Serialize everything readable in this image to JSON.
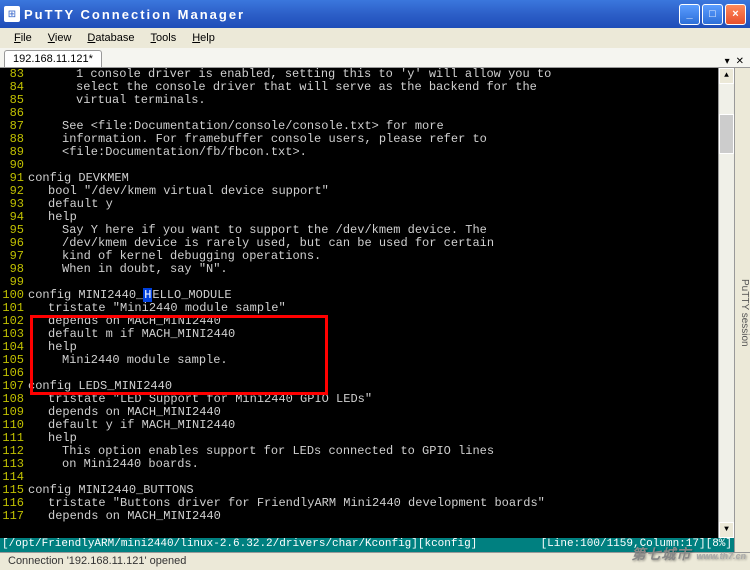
{
  "window": {
    "title": "PuTTY Connection Manager"
  },
  "menu": {
    "file": "File",
    "view": "View",
    "database": "Database",
    "tools": "Tools",
    "help": "Help"
  },
  "tab": {
    "label": "192.168.11.121*"
  },
  "sidetab": {
    "label": "PuTTY session"
  },
  "lines": [
    {
      "n": "83",
      "ind": "ind4",
      "t": "1 console driver is enabled, setting this to 'y' will allow you to"
    },
    {
      "n": "84",
      "ind": "ind4",
      "t": "select the console driver that will serve as the backend for the"
    },
    {
      "n": "85",
      "ind": "ind4",
      "t": "virtual terminals."
    },
    {
      "n": "86",
      "ind": "ind1",
      "t": ""
    },
    {
      "n": "87",
      "ind": "ind3",
      "t": "See <file:Documentation/console/console.txt> for more"
    },
    {
      "n": "88",
      "ind": "ind3",
      "t": "information. For framebuffer console users, please refer to"
    },
    {
      "n": "89",
      "ind": "ind3",
      "t": "<file:Documentation/fb/fbcon.txt>."
    },
    {
      "n": "90",
      "ind": "ind1",
      "t": ""
    },
    {
      "n": "91",
      "ind": "ind1",
      "t": "config DEVKMEM"
    },
    {
      "n": "92",
      "ind": "ind2",
      "t": "bool \"/dev/kmem virtual device support\""
    },
    {
      "n": "93",
      "ind": "ind2",
      "t": "default y"
    },
    {
      "n": "94",
      "ind": "ind2",
      "t": "help"
    },
    {
      "n": "95",
      "ind": "ind3",
      "t": "Say Y here if you want to support the /dev/kmem device. The"
    },
    {
      "n": "96",
      "ind": "ind3",
      "t": "/dev/kmem device is rarely used, but can be used for certain"
    },
    {
      "n": "97",
      "ind": "ind3",
      "t": "kind of kernel debugging operations."
    },
    {
      "n": "98",
      "ind": "ind3",
      "t": "When in doubt, say \"N\"."
    },
    {
      "n": "99",
      "ind": "ind1",
      "t": ""
    },
    {
      "n": "100",
      "ind": "ind1",
      "t": "config MINI2440_"
    },
    {
      "n": "101",
      "ind": "ind2",
      "t": "tristate \"Mini2440 module sample\""
    },
    {
      "n": "102",
      "ind": "ind2",
      "t": "depends on MACH_MINI2440"
    },
    {
      "n": "103",
      "ind": "ind2",
      "t": "default m if MACH_MINI2440"
    },
    {
      "n": "104",
      "ind": "ind2",
      "t": "help"
    },
    {
      "n": "105",
      "ind": "ind3",
      "t": "Mini2440 module sample."
    },
    {
      "n": "106",
      "ind": "ind1",
      "t": ""
    },
    {
      "n": "107",
      "ind": "ind1",
      "t": "config LEDS_MINI2440"
    },
    {
      "n": "108",
      "ind": "ind2",
      "t": "tristate \"LED Support for Mini2440 GPIO LEDs\""
    },
    {
      "n": "109",
      "ind": "ind2",
      "t": "depends on MACH_MINI2440"
    },
    {
      "n": "110",
      "ind": "ind2",
      "t": "default y if MACH_MINI2440"
    },
    {
      "n": "111",
      "ind": "ind2",
      "t": "help"
    },
    {
      "n": "112",
      "ind": "ind3",
      "t": "This option enables support for LEDs connected to GPIO lines"
    },
    {
      "n": "113",
      "ind": "ind3",
      "t": "on Mini2440 boards."
    },
    {
      "n": "114",
      "ind": "ind1",
      "t": ""
    },
    {
      "n": "115",
      "ind": "ind1",
      "t": "config MINI2440_BUTTONS"
    },
    {
      "n": "116",
      "ind": "ind2",
      "t": "tristate \"Buttons driver for FriendlyARM Mini2440 development boards\""
    },
    {
      "n": "117",
      "ind": "ind2",
      "t": "depends on MACH_MINI2440"
    }
  ],
  "cursor": {
    "pre": "H",
    "post": "ELLO_MODULE"
  },
  "status_term": {
    "left": "[/opt/FriendlyARM/mini2440/linux-2.6.32.2/drivers/char/Kconfig][kconfig]",
    "right": "[Line:100/1159,Column:17][8%]"
  },
  "status_app": {
    "text": "Connection '192.168.11.121' opened"
  },
  "watermark": {
    "main": "第七城市",
    "sub": "www.th7.cn"
  }
}
